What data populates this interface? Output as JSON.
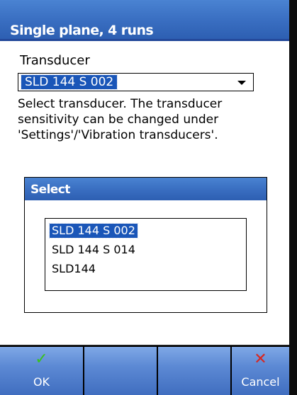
{
  "window": {
    "title": "Single plane, 4 runs"
  },
  "form": {
    "field_label": "Transducer",
    "dropdown_value": "SLD 144 S 002",
    "help_lines": [
      "Select transducer. The transducer",
      "sensitivity can be changed under",
      "'Settings'/'Vibration transducers'."
    ]
  },
  "select_dialog": {
    "title": "Select",
    "items": [
      {
        "label": "SLD 144 S 002",
        "selected": true
      },
      {
        "label": "SLD 144 S 014",
        "selected": false
      },
      {
        "label": "SLD144",
        "selected": false
      }
    ]
  },
  "softkeys": {
    "ok": {
      "label": "OK",
      "icon": "check-icon",
      "color": "#39c21c"
    },
    "cancel": {
      "label": "Cancel",
      "icon": "x-icon",
      "color": "#d8261f"
    }
  },
  "colors": {
    "titlebar": "#3a6fc2",
    "selection": "#1a56b8",
    "softkey": "#5c89d4"
  }
}
